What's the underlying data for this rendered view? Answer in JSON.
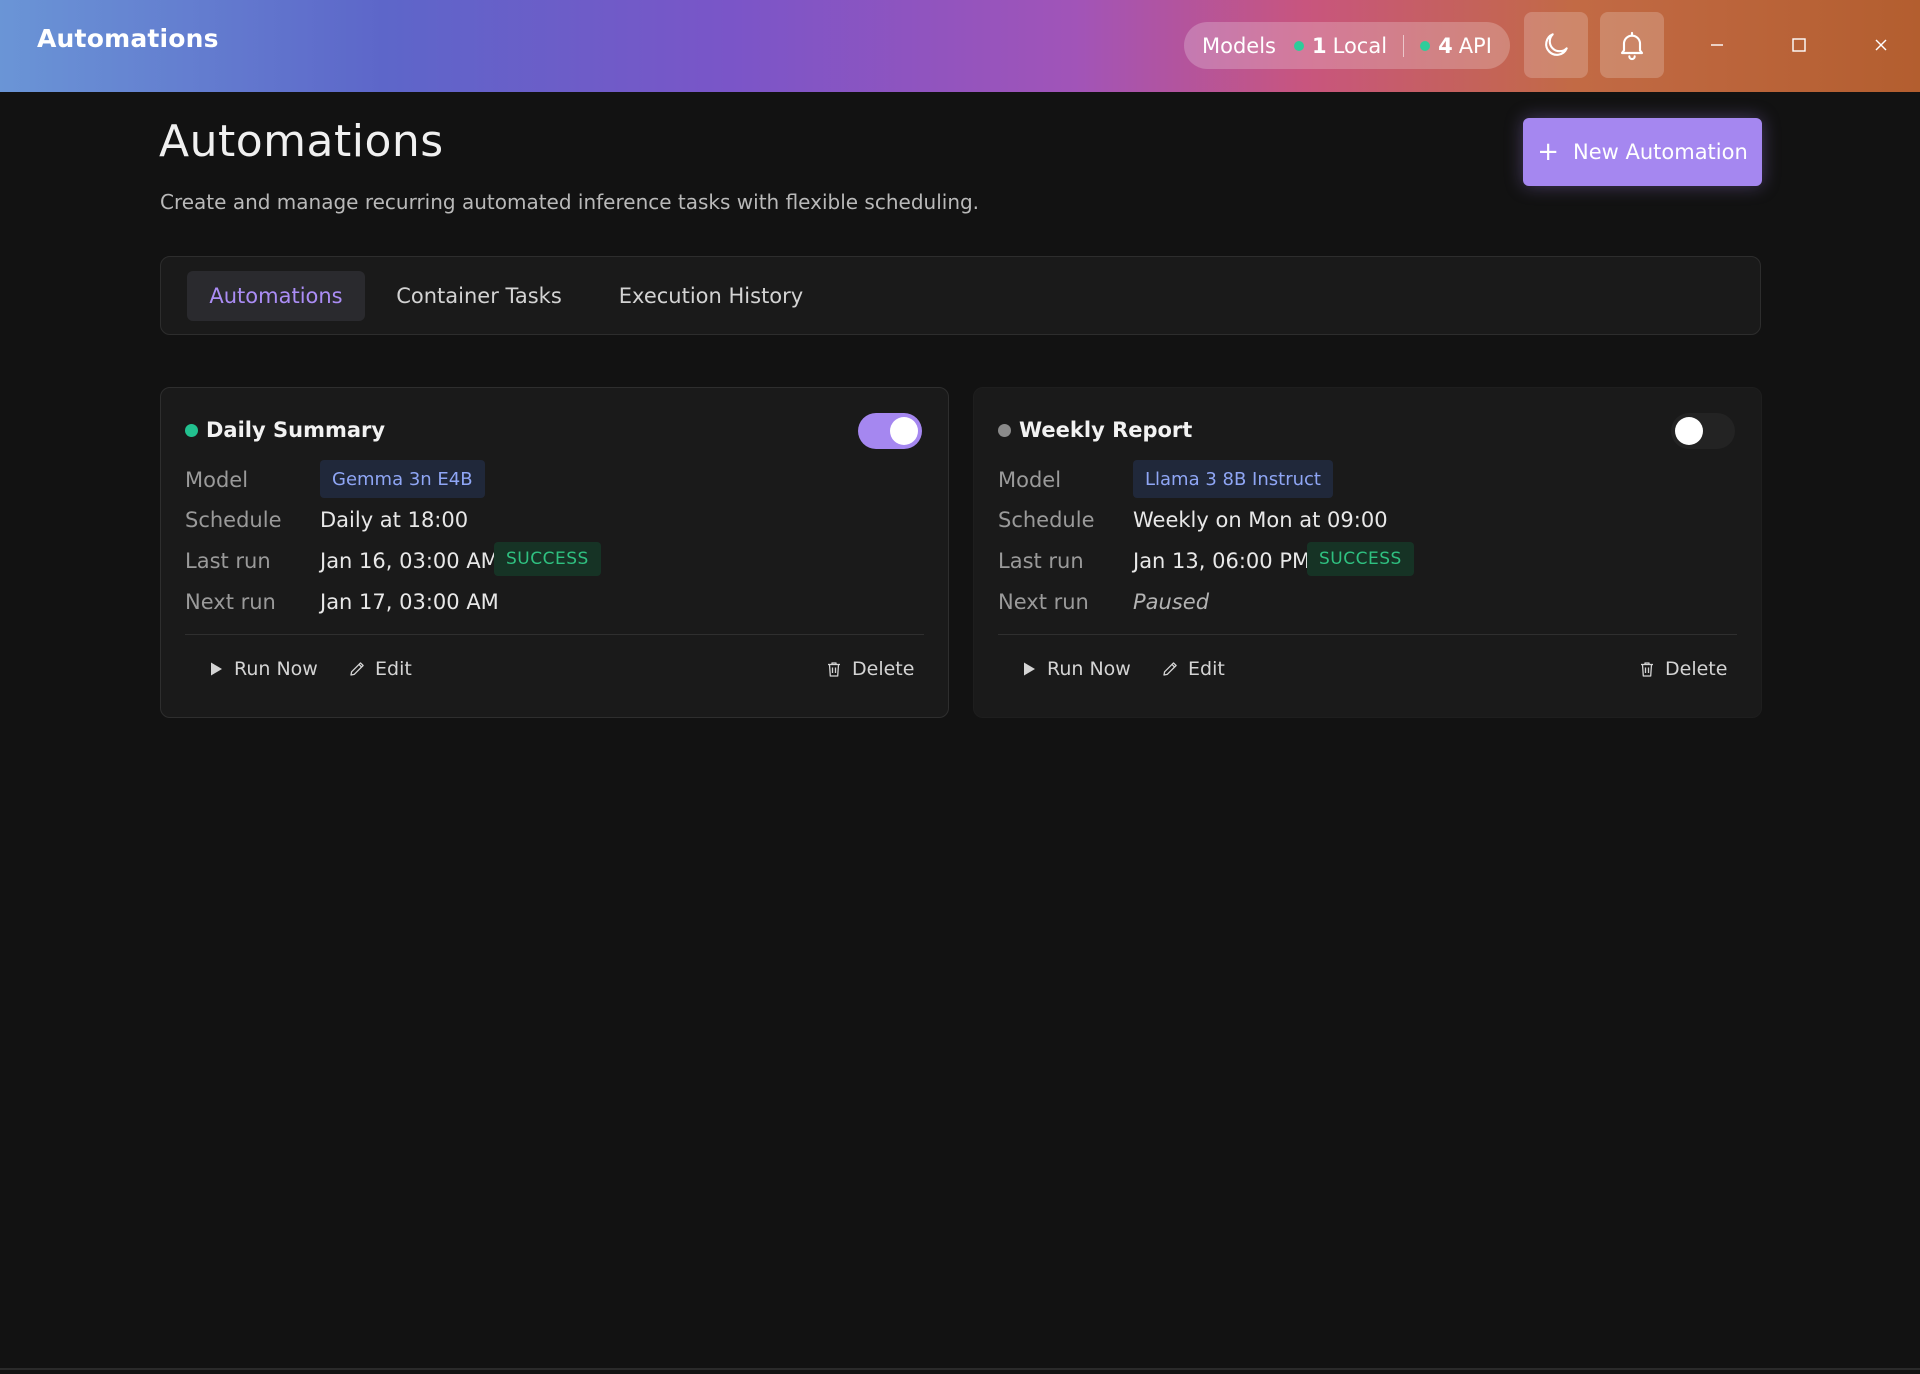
{
  "window": {
    "title": "Automations",
    "models_label": "Models",
    "local_count": "1",
    "local_label": "Local",
    "api_count": "4",
    "api_label": "API",
    "theme_icon": "moon-icon",
    "notification_icon": "bell-icon"
  },
  "header": {
    "title": "Automations",
    "subtitle": "Create and manage recurring automated inference tasks with flexible scheduling.",
    "new_button": "New Automation"
  },
  "tabs": [
    {
      "label": "Automations",
      "active": true
    },
    {
      "label": "Container Tasks",
      "active": false
    },
    {
      "label": "Execution History",
      "active": false
    }
  ],
  "labels": {
    "model": "Model",
    "schedule": "Schedule",
    "last_run": "Last run",
    "next_run": "Next run",
    "run_now": "Run Now",
    "edit": "Edit",
    "delete": "Delete"
  },
  "automations": [
    {
      "name": "Daily Summary",
      "enabled": true,
      "status_color": "#22c18f",
      "model": "Gemma 3n E4B",
      "schedule": "Daily at 18:00",
      "last_run": "Jan 16, 03:00 AM",
      "last_status": "SUCCESS",
      "next_run": "Jan 17, 03:00 AM"
    },
    {
      "name": "Weekly Report",
      "enabled": false,
      "status_color": "#8a8a8a",
      "model": "Llama 3 8B Instruct",
      "schedule": "Weekly on Mon at 09:00",
      "last_run": "Jan 13, 06:00 PM",
      "last_status": "SUCCESS",
      "next_run": "Paused"
    }
  ],
  "colors": {
    "accent": "#a587f0",
    "background": "#121212",
    "card": "#1a1a1a",
    "success": "#2fc080",
    "toggle_on": "#a587f0",
    "toggle_off": "#2a2a2a"
  }
}
